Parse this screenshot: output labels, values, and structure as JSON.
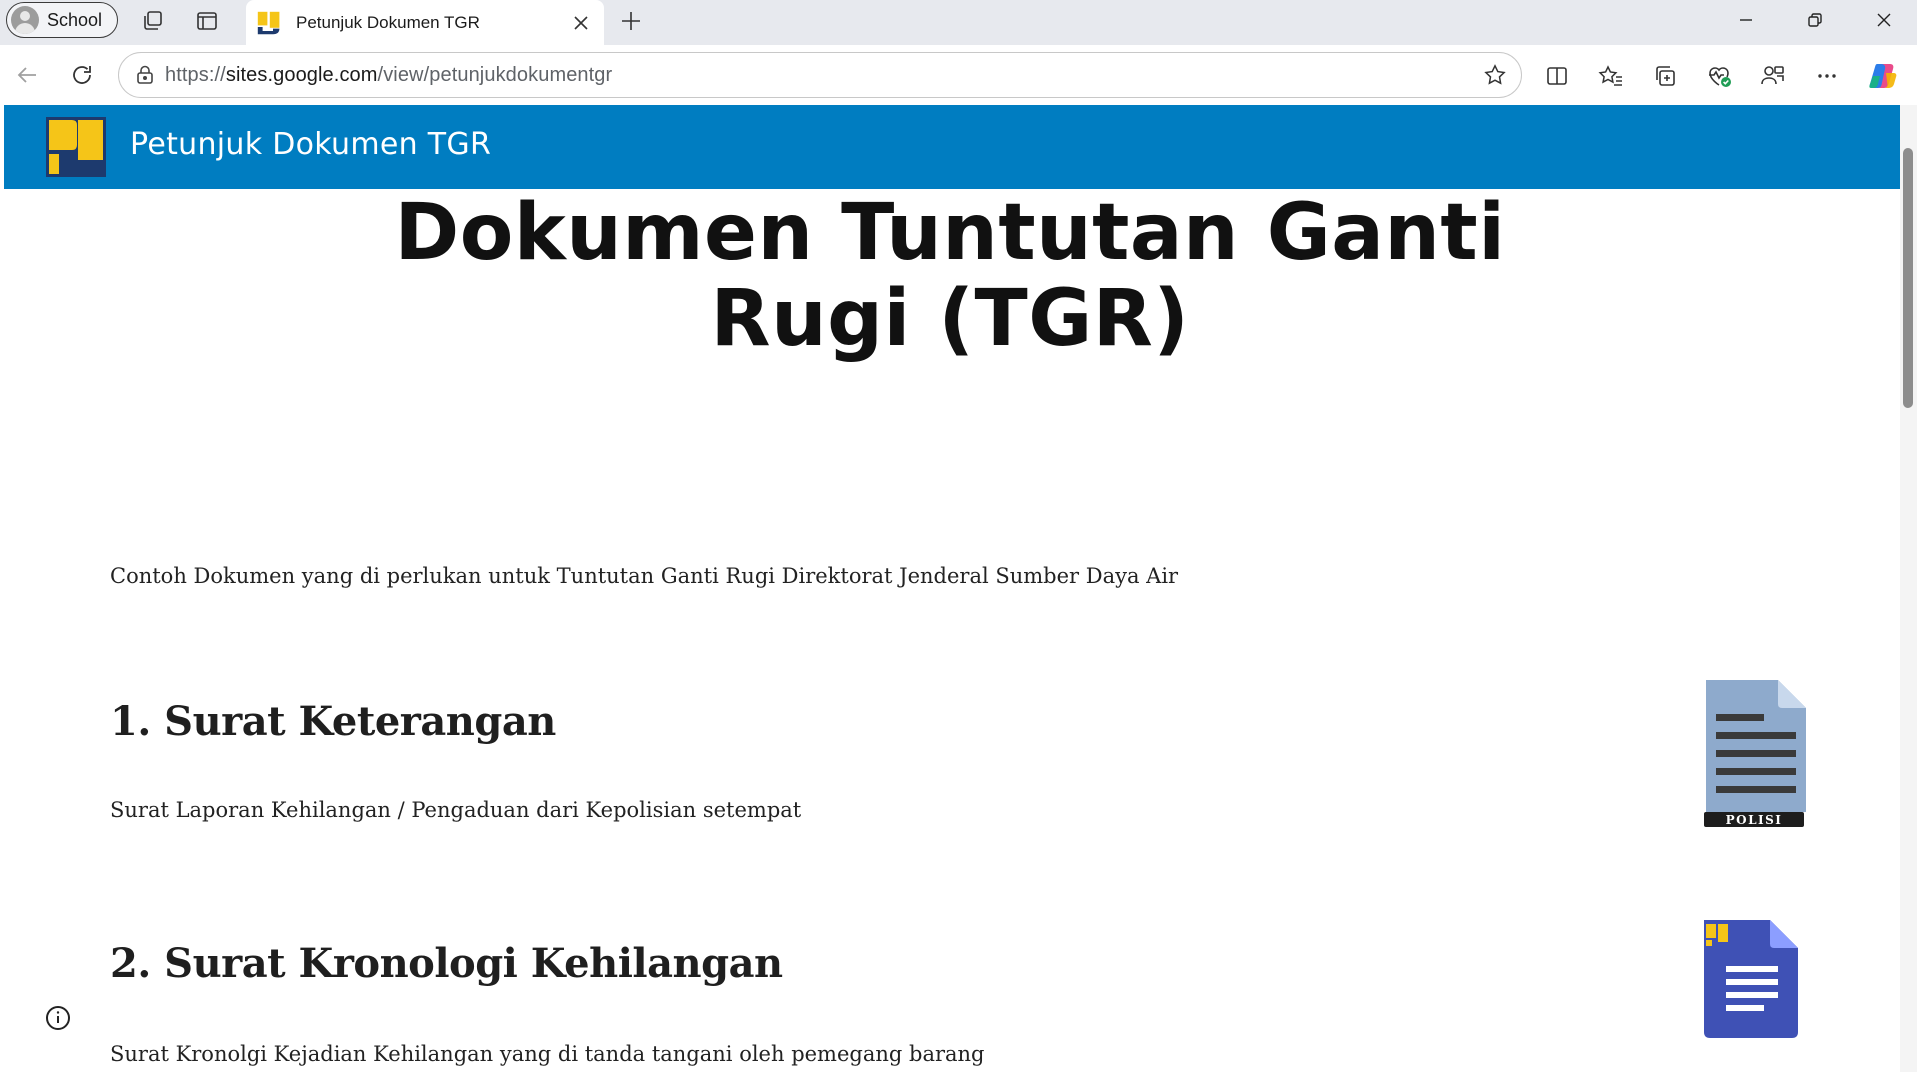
{
  "browser": {
    "profile_label": "School",
    "tab": {
      "title": "Petunjuk Dokumen TGR"
    },
    "address": {
      "scheme": "https://",
      "host": "sites.google.com",
      "path": "/view/petunjukdokumentgr"
    }
  },
  "site": {
    "header_title": "Petunjuk Dokumen TGR",
    "brand_colors": {
      "header_bg": "#007dc1",
      "logo_yellow": "#f5c518",
      "logo_navy": "#1d3a6e"
    }
  },
  "content": {
    "heading": "Dokumen Tuntutan Ganti Rugi (TGR)",
    "intro": "Contoh Dokumen yang di perlukan untuk Tuntutan Ganti Rugi Direktorat Jenderal Sumber Daya Air",
    "sections": [
      {
        "title": "1. Surat Keterangan",
        "text": "Surat Laporan Kehilangan / Pengaduan dari Kepolisian setempat",
        "icon": "police-document-icon",
        "icon_label": "POLISI"
      },
      {
        "title": "2. Surat Kronologi Kehilangan",
        "text": "Surat Kronolgi Kejadian Kehilangan yang di tanda tangani oleh pemegang barang",
        "icon": "docs-document-icon"
      }
    ]
  },
  "icons": {
    "info": "info-icon",
    "back": "back-arrow-icon",
    "refresh": "refresh-icon",
    "lock": "lock-icon",
    "favorite": "star-icon"
  }
}
